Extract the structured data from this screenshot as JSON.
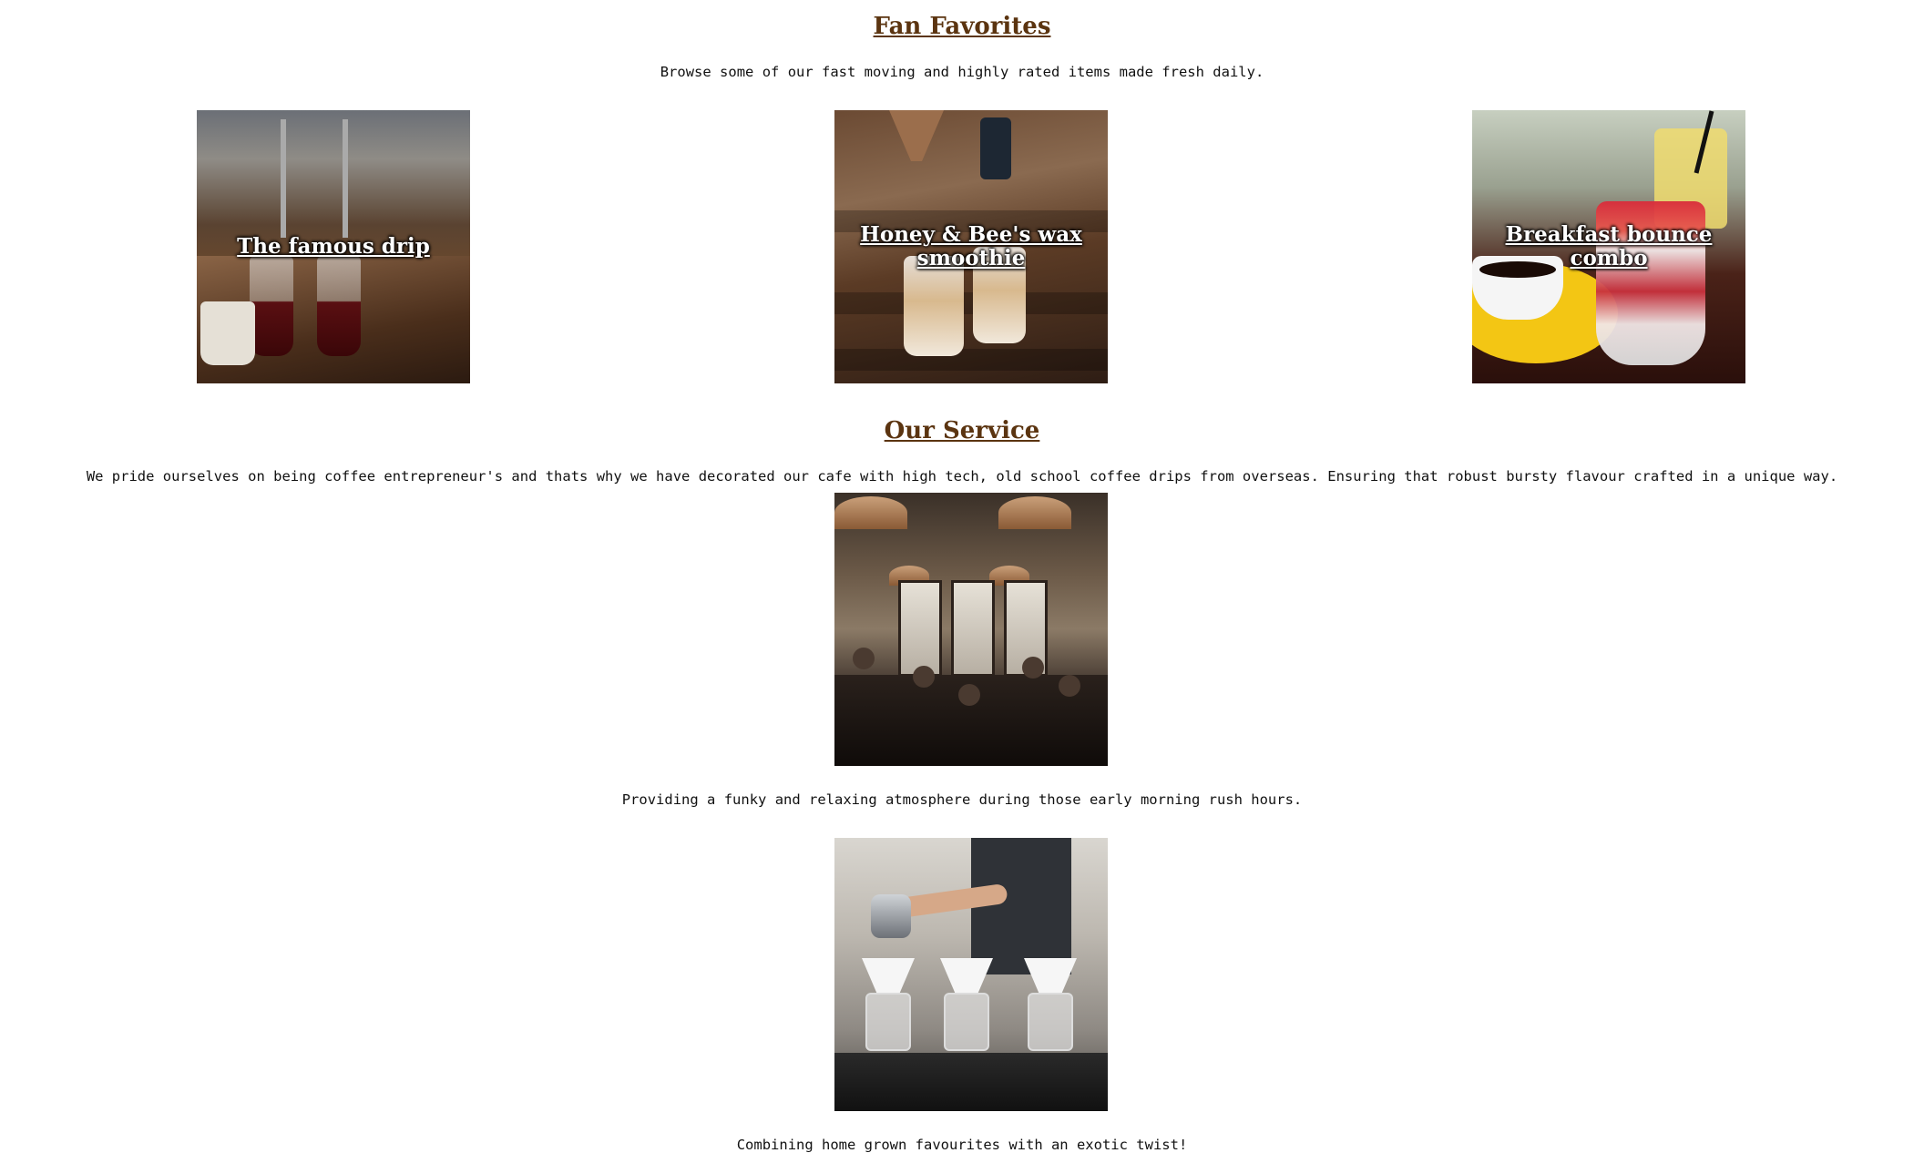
{
  "fan_favorites": {
    "heading": "Fan Favorites",
    "intro": "Browse some of our fast moving and highly rated items made fresh daily.",
    "items": [
      {
        "label": "The famous drip"
      },
      {
        "label": "Honey & Bee's wax smoothie"
      },
      {
        "label": "Breakfast bounce combo"
      }
    ]
  },
  "service": {
    "heading": "Our Service",
    "intro": "We pride ourselves on being coffee entrepreneur's and thats why we have decorated our cafe with high tech, old school coffee drips from overseas. Ensuring that robust bursty flavour crafted in a unique way.",
    "caption_1": "Providing a funky and relaxing atmosphere during those early morning rush hours.",
    "caption_2": "Combining home grown favourites with an exotic twist!"
  }
}
